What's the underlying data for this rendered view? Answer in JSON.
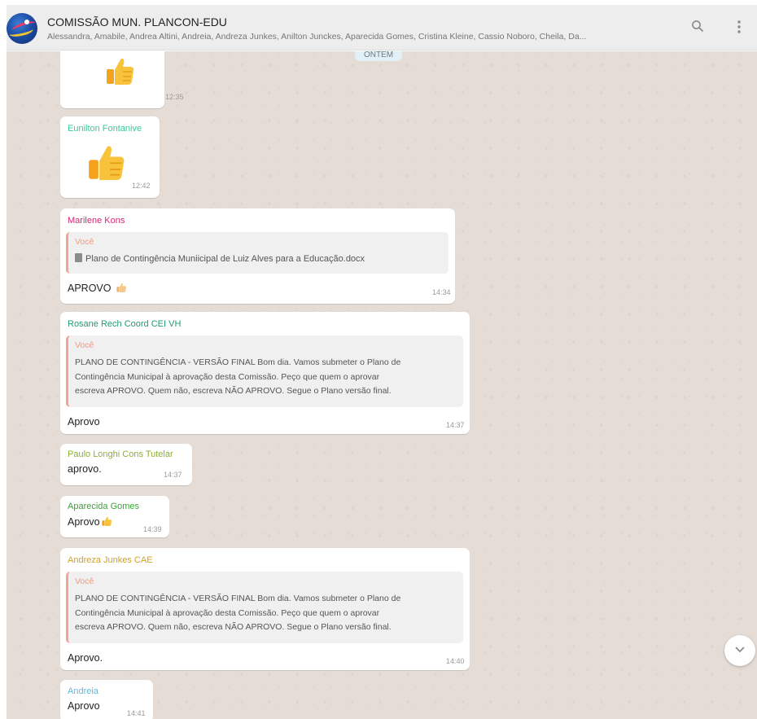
{
  "header": {
    "title": "COMISSÃO MUN. PLANCON-EDU",
    "participants": "Alessandra, Amabile, Andrea Altini, Andreia, Andreza Junkes, Anilton Junckes, Aparecida Gomes, Cristina Kleine, Cassio Noboro, Cheila, Da...",
    "search_icon": "search-icon",
    "menu_icon": "menu-dots-icon"
  },
  "date_divider": "ONTEM",
  "messages": [
    {
      "sender": "",
      "sticker": "thumbs-up",
      "time": "12:35"
    },
    {
      "sender": "Eunilton Fontanive",
      "sender_color": "#35cd96",
      "sticker": "thumbs-up",
      "time": "12:42"
    },
    {
      "sender": "Marilene Kons",
      "sender_color": "#d62976",
      "quote_from": "Você",
      "quote_doc": "Plano de Contingência Muniicipal de Luiz Alves para a Educação.docx",
      "text": "APROVO",
      "time": "14:34"
    },
    {
      "sender": "Rosane Rech Coord CEI VH",
      "sender_color": "#1f9f6f",
      "quote_from": "Você",
      "quote_lines": [
        "PLANO DE CONTINGÊNCIA - VERSÃO FINAL    Bom dia. Vamos submeter o Plano de",
        "Contingência Municipal à aprovação desta Comissão. Peço que quem o aprovar",
        "escreva APROVO. Quem não, escreva NÃO APROVO. Segue o Plano versão final."
      ],
      "text": "Aprovo",
      "time": "14:37"
    },
    {
      "sender": "Paulo Longhi Cons Tutelar",
      "sender_color": "#8ab22e",
      "text": "aprovo.",
      "time": "14:37"
    },
    {
      "sender": "Aparecida Gomes",
      "sender_color": "#3aa335",
      "text": "Aprovo",
      "time": "14:39"
    },
    {
      "sender": "Andreza Junkes CAE",
      "sender_color": "#d3a21f",
      "quote_from": "Você",
      "quote_lines": [
        "PLANO DE CONTINGÊNCIA - VERSÃO FINAL    Bom dia. Vamos submeter o Plano de",
        "Contingência Municipal à aprovação desta Comissão. Peço que quem o aprovar",
        "escreva APROVO. Quem não, escreva NÃO APROVO. Segue o Plano versão final."
      ],
      "text": "Aprovo.",
      "time": "14:40"
    },
    {
      "sender": "Andreia",
      "sender_color": "#53bdeb",
      "text": "Aprovo",
      "time": "14:41"
    }
  ],
  "scroll_down_icon": "chevron-down-icon"
}
